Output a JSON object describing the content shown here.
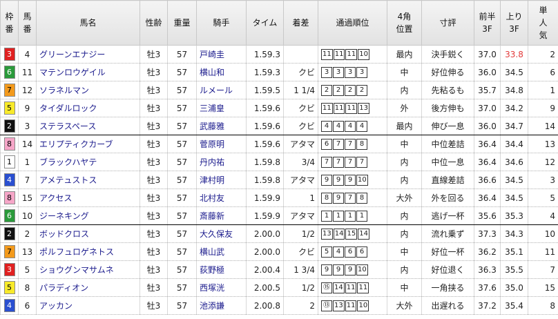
{
  "headers": {
    "waku": [
      "枠",
      "番"
    ],
    "umaban": [
      "馬",
      "番"
    ],
    "name": "馬名",
    "sexage": "性齢",
    "weight": "重量",
    "jockey": "騎手",
    "time": "タイム",
    "margin": "着差",
    "passing": "通過順位",
    "corner4": [
      "4角",
      "位置"
    ],
    "comment": "寸評",
    "first3f": [
      "前半",
      "3F"
    ],
    "last3f": [
      "上り",
      "3F"
    ],
    "popularity": [
      "単",
      "人",
      "気"
    ]
  },
  "waku_colors": {
    "1": {
      "bg": "#ffffff",
      "fg": "#000000"
    },
    "2": {
      "bg": "#111111",
      "fg": "#ffffff"
    },
    "3": {
      "bg": "#e02020",
      "fg": "#ffffff"
    },
    "4": {
      "bg": "#2a4fd0",
      "fg": "#ffffff"
    },
    "5": {
      "bg": "#f8ea2a",
      "fg": "#000000"
    },
    "6": {
      "bg": "#2a9a3a",
      "fg": "#ffffff"
    },
    "7": {
      "bg": "#f39a1c",
      "fg": "#000000"
    },
    "8": {
      "bg": "#f6a6c8",
      "fg": "#000000"
    }
  },
  "rows": [
    {
      "waku": "3",
      "umaban": "4",
      "name": "グリーンエナジー",
      "sexage": "牡3",
      "weight": "57",
      "jockey": "戸崎圭",
      "time": "1.59.3",
      "margin": "",
      "passing": [
        "11",
        "11",
        "11",
        "10"
      ],
      "corner4": "最内",
      "comment": "決手鋭く",
      "first3f": "37.0",
      "last3f": "33.8",
      "last3f_red": true,
      "pop": "2",
      "sep": false
    },
    {
      "waku": "6",
      "umaban": "11",
      "name": "マテンロウゲイル",
      "sexage": "牡3",
      "weight": "57",
      "jockey": "横山和",
      "time": "1.59.3",
      "margin": "クビ",
      "passing": [
        "3",
        "3",
        "3",
        "3"
      ],
      "corner4": "中",
      "comment": "好位伸る",
      "first3f": "36.0",
      "last3f": "34.5",
      "last3f_red": false,
      "pop": "6",
      "sep": false
    },
    {
      "waku": "7",
      "umaban": "12",
      "name": "ソラネルマン",
      "sexage": "牡3",
      "weight": "57",
      "jockey": "ルメール",
      "time": "1.59.5",
      "margin": "1 1/4",
      "passing": [
        "2",
        "2",
        "2",
        "2"
      ],
      "corner4": "内",
      "comment": "先粘るも",
      "first3f": "35.7",
      "last3f": "34.8",
      "last3f_red": false,
      "pop": "1",
      "sep": false
    },
    {
      "waku": "5",
      "umaban": "9",
      "name": "タイダルロック",
      "sexage": "牡3",
      "weight": "57",
      "jockey": "三浦皇",
      "time": "1.59.6",
      "margin": "クビ",
      "passing": [
        "11",
        "11",
        "11",
        "13"
      ],
      "corner4": "外",
      "comment": "後方伸も",
      "first3f": "37.0",
      "last3f": "34.2",
      "last3f_red": false,
      "pop": "9",
      "sep": false
    },
    {
      "waku": "2",
      "umaban": "3",
      "name": "ステラスペース",
      "sexage": "牡3",
      "weight": "57",
      "jockey": "武藤雅",
      "time": "1.59.6",
      "margin": "クビ",
      "passing": [
        "4",
        "4",
        "4",
        "4"
      ],
      "corner4": "最内",
      "comment": "伸び一息",
      "first3f": "36.0",
      "last3f": "34.7",
      "last3f_red": false,
      "pop": "14",
      "sep": true
    },
    {
      "waku": "8",
      "umaban": "14",
      "name": "エリプティクカーブ",
      "sexage": "牡3",
      "weight": "57",
      "jockey": "菅原明",
      "time": "1.59.6",
      "margin": "アタマ",
      "passing": [
        "6",
        "7",
        "7",
        "8"
      ],
      "corner4": "中",
      "comment": "中位差詰",
      "first3f": "36.4",
      "last3f": "34.4",
      "last3f_red": false,
      "pop": "13",
      "sep": false
    },
    {
      "waku": "1",
      "umaban": "1",
      "name": "ブラックハヤテ",
      "sexage": "牡3",
      "weight": "57",
      "jockey": "丹内祐",
      "time": "1.59.8",
      "margin": "3/4",
      "passing": [
        "7",
        "7",
        "7",
        "7"
      ],
      "corner4": "内",
      "comment": "中位一息",
      "first3f": "36.4",
      "last3f": "34.6",
      "last3f_red": false,
      "pop": "12",
      "sep": false
    },
    {
      "waku": "4",
      "umaban": "7",
      "name": "アメテュストス",
      "sexage": "牡3",
      "weight": "57",
      "jockey": "津村明",
      "time": "1.59.8",
      "margin": "アタマ",
      "passing": [
        "9",
        "9",
        "9",
        "10"
      ],
      "corner4": "内",
      "comment": "直線差詰",
      "first3f": "36.6",
      "last3f": "34.5",
      "last3f_red": false,
      "pop": "3",
      "sep": false
    },
    {
      "waku": "8",
      "umaban": "15",
      "name": "アクセス",
      "sexage": "牡3",
      "weight": "57",
      "jockey": "北村友",
      "time": "1.59.9",
      "margin": "1",
      "passing": [
        "8",
        "9",
        "7",
        "8"
      ],
      "corner4": "大外",
      "comment": "外を回る",
      "first3f": "36.4",
      "last3f": "34.5",
      "last3f_red": false,
      "pop": "5",
      "sep": false
    },
    {
      "waku": "6",
      "umaban": "10",
      "name": "ジーネキング",
      "sexage": "牡3",
      "weight": "57",
      "jockey": "斎藤新",
      "time": "1.59.9",
      "margin": "アタマ",
      "passing": [
        "1",
        "1",
        "1",
        "1"
      ],
      "corner4": "内",
      "comment": "逃げ一杯",
      "first3f": "35.6",
      "last3f": "35.3",
      "last3f_red": false,
      "pop": "4",
      "sep": true
    },
    {
      "waku": "2",
      "umaban": "2",
      "name": "ボッドクロス",
      "sexage": "牡3",
      "weight": "57",
      "jockey": "大久保友",
      "time": "2.00.0",
      "margin": "1/2",
      "passing": [
        "13",
        "14",
        "15",
        "14"
      ],
      "corner4": "内",
      "comment": "流れ乗ず",
      "first3f": "37.3",
      "last3f": "34.3",
      "last3f_red": false,
      "pop": "10",
      "sep": false
    },
    {
      "waku": "7",
      "umaban": "13",
      "name": "ポルフュロゲネトス",
      "sexage": "牡3",
      "weight": "57",
      "jockey": "横山武",
      "time": "2.00.0",
      "margin": "クビ",
      "passing": [
        "5",
        "4",
        "6",
        "6"
      ],
      "corner4": "中",
      "comment": "好位一杯",
      "first3f": "36.2",
      "last3f": "35.1",
      "last3f_red": false,
      "pop": "11",
      "sep": false
    },
    {
      "waku": "3",
      "umaban": "5",
      "name": "ショウグンマサムネ",
      "sexage": "牡3",
      "weight": "57",
      "jockey": "荻野極",
      "time": "2.00.4",
      "margin": "1 3/4",
      "passing": [
        "9",
        "9",
        "9",
        "10"
      ],
      "corner4": "内",
      "comment": "好位退く",
      "first3f": "36.3",
      "last3f": "35.5",
      "last3f_red": false,
      "pop": "7",
      "sep": false
    },
    {
      "waku": "5",
      "umaban": "8",
      "name": "パラディオン",
      "sexage": "牡3",
      "weight": "57",
      "jockey": "西塚洸",
      "time": "2.00.5",
      "margin": "1/2",
      "passing": [
        "⑮",
        "14",
        "11",
        "11"
      ],
      "corner4": "中",
      "comment": "一角挟る",
      "first3f": "37.6",
      "last3f": "35.0",
      "last3f_red": false,
      "pop": "15",
      "sep": false
    },
    {
      "waku": "4",
      "umaban": "6",
      "name": "アッカン",
      "sexage": "牡3",
      "weight": "57",
      "jockey": "池添謙",
      "time": "2.00.8",
      "margin": "2",
      "passing": [
        "⑬",
        "13",
        "11",
        "10"
      ],
      "corner4": "大外",
      "comment": "出遅れる",
      "first3f": "37.2",
      "last3f": "35.4",
      "last3f_red": false,
      "pop": "8",
      "sep": false
    }
  ]
}
